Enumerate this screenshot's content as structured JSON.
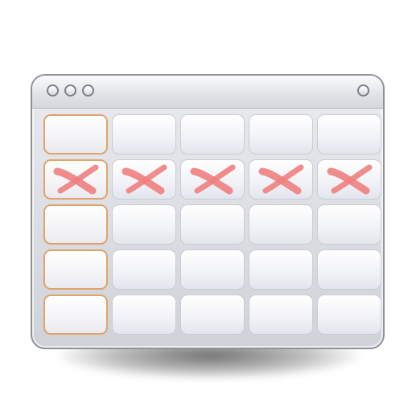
{
  "icon": {
    "name": "spreadsheet-delete-row-icon",
    "columns": 5,
    "rows": 5,
    "marked_row": 2
  },
  "titlebar": {
    "left_buttons": [
      "window-button-1",
      "window-button-2",
      "window-button-3"
    ],
    "right_buttons": [
      "window-button-right"
    ]
  },
  "colors": {
    "frame": "#8f9399",
    "header_cell_border": "#e0a36a",
    "cell_border": "#c9ccd3",
    "delete_mark": "#f08080"
  }
}
